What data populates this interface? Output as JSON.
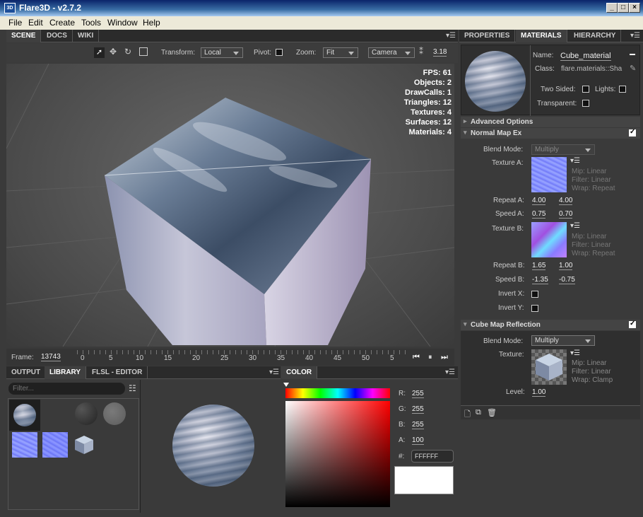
{
  "window": {
    "title": "Flare3D - v2.7.2",
    "logo": "3D"
  },
  "menu": [
    "File",
    "Edit",
    "Create",
    "Tools",
    "Window",
    "Help"
  ],
  "viewport_tabs": [
    "SCENE",
    "DOCS",
    "WIKI"
  ],
  "toolbar": {
    "transform_label": "Transform:",
    "transform_value": "Local",
    "pivot_label": "Pivot:",
    "zoom_label": "Zoom:",
    "zoom_value": "Fit",
    "camera_value": "Camera",
    "speed_value": "3.18"
  },
  "stats": [
    "FPS: 61",
    "Objects: 2",
    "DrawCalls: 1",
    "Triangles: 12",
    "Textures: 4",
    "Surfaces: 12",
    "Materials: 4"
  ],
  "timeline": {
    "frame_label": "Frame:",
    "frame_value": "13743",
    "ticks": [
      "0",
      "5",
      "10",
      "15",
      "20",
      "25",
      "30",
      "35",
      "40",
      "45",
      "50",
      "5"
    ]
  },
  "bottom_tabs": [
    "OUTPUT",
    "LIBRARY",
    "FLSL - EDITOR"
  ],
  "library": {
    "filter_placeholder": "Filter..."
  },
  "color_panel": {
    "tab": "COLOR",
    "r_label": "R:",
    "r": "255",
    "g_label": "G:",
    "g": "255",
    "b_label": "B:",
    "b": "255",
    "a_label": "A:",
    "a": "100",
    "hex_label": "#:",
    "hex": "FFFFFF"
  },
  "right_tabs": [
    "PROPERTIES",
    "MATERIALS",
    "HIERARCHY"
  ],
  "material": {
    "name_label": "Name:",
    "name": "Cube_material",
    "class_label": "Class:",
    "class": "flare.materials::Sha",
    "two_sided": "Two Sided:",
    "lights": "Lights:",
    "transparent": "Transparent:"
  },
  "sections": {
    "advanced": "Advanced Options",
    "normal": "Normal Map Ex",
    "cube": "Cube Map Reflection"
  },
  "normal_map": {
    "blend_label": "Blend Mode:",
    "blend": "Multiply",
    "texA_label": "Texture A:",
    "texA_info": [
      "Mip: Linear",
      "Filter: Linear",
      "Wrap: Repeat"
    ],
    "repeatA_label": "Repeat A:",
    "repeatA": [
      "4.00",
      "4.00"
    ],
    "speedA_label": "Speed A:",
    "speedA": [
      "0.75",
      "0.70"
    ],
    "texB_label": "Texture B:",
    "texB_info": [
      "Mip: Linear",
      "Filter: Linear",
      "Wrap: Repeat"
    ],
    "repeatB_label": "Repeat B:",
    "repeatB": [
      "1.65",
      "1.00"
    ],
    "speedB_label": "Speed B:",
    "speedB": [
      "-1.35",
      "-0.75"
    ],
    "invertX": "Invert X:",
    "invertY": "Invert Y:"
  },
  "cube_map": {
    "blend_label": "Blend Mode:",
    "blend": "Multiply",
    "tex_label": "Texture:",
    "tex_info": [
      "Mip: Linear",
      "Filter: Linear",
      "Wrap: Clamp"
    ],
    "level_label": "Level:",
    "level": "1.00"
  }
}
